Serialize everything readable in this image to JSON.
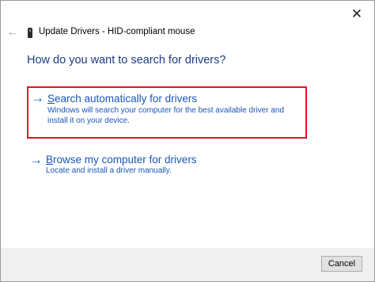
{
  "window": {
    "title": "Update Drivers - HID-compliant mouse",
    "close_glyph": "✕",
    "back_glyph": "←"
  },
  "heading": "How do you want to search for drivers?",
  "options": [
    {
      "arrow": "→",
      "title_first": "S",
      "title_rest": "earch automatically for drivers",
      "description": "Windows will search your computer for the best available driver and install it on your device.",
      "highlighted": true
    },
    {
      "arrow": "→",
      "title_first": "B",
      "title_rest": "rowse my computer for drivers",
      "description": "Locate and install a driver manually.",
      "highlighted": false
    }
  ],
  "footer": {
    "cancel_label": "Cancel"
  },
  "colors": {
    "link": "#1a56b8",
    "heading": "#1a3b84",
    "highlight_border": "#e81123"
  }
}
